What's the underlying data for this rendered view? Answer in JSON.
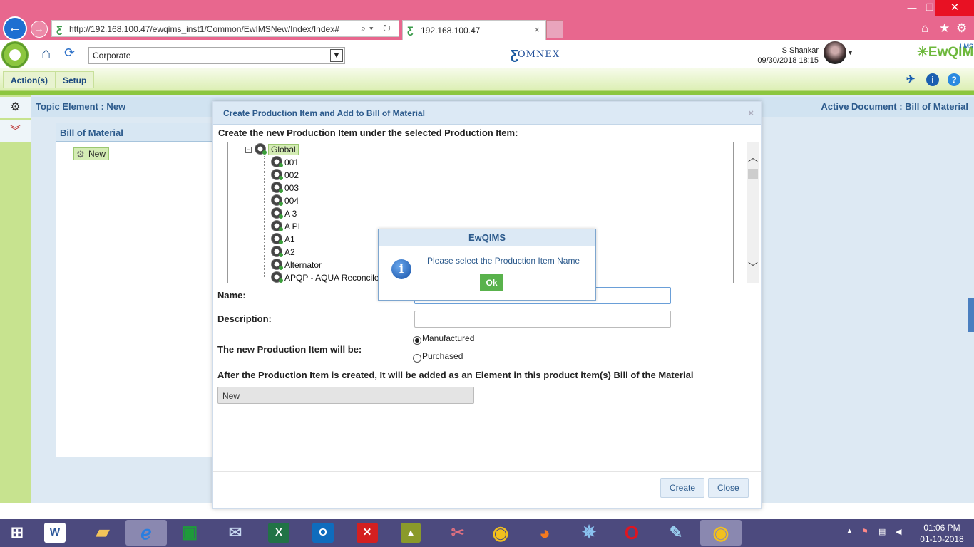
{
  "browser": {
    "url": "http://192.168.100.47/ewqims_inst1/Common/EwIMSNew/Index/Index#",
    "tab_title": "192.168.100.47",
    "tab_close": "×",
    "url_tools": "⌕▾ ↻"
  },
  "header": {
    "org_select_value": "Corporate",
    "omnex_brand": "OMNEX",
    "user_name": "S Shankar",
    "user_datetime": "09/30/2018 18:15",
    "app_brand": "EwQIMS",
    "app_brand_lms": "LMS"
  },
  "toolbar": {
    "actions_label": "Action(s)",
    "setup_label": "Setup"
  },
  "page": {
    "topic_title": "Topic Element : New",
    "active_document": "Active Document : Bill of Material",
    "bom_title": "Bill of Material",
    "bom_node": "New"
  },
  "modal": {
    "title": "Create Production Item and Add to Bill of Material",
    "subtitle": "Create the new Production Item under the selected Production Item:",
    "tree_root": "Global",
    "tree_items": [
      "001",
      "002",
      "003",
      "004",
      "A 3",
      "A PI",
      "A1",
      "A2",
      "Alternator",
      "APQP - AQUA Reconcile"
    ],
    "name_label": "Name:",
    "description_label": "Description:",
    "item_type_label": "The new Production Item will be:",
    "option_manufactured": "Manufactured",
    "option_purchased": "Purchased",
    "selected_option": "Manufactured",
    "info_text": "After the Production Item is created, It will be added as an Element in this product item(s) Bill of the Material",
    "parent_value": "New",
    "create_label": "Create",
    "close_label": "Close"
  },
  "alert": {
    "title": "EwQIMS",
    "message": "Please select the Production Item Name",
    "ok_label": "Ok"
  },
  "taskbar": {
    "time": "01:06 PM",
    "date": "01-10-2018",
    "apps": [
      "start",
      "word",
      "file-explorer",
      "internet-explorer",
      "store",
      "thunderbird",
      "excel",
      "outlook",
      "app-red",
      "app-chart",
      "app-paint",
      "chrome",
      "firefox",
      "safari",
      "opera",
      "paint",
      "chrome"
    ]
  },
  "colors": {
    "browser_bar": "#e8678e",
    "toolbar_green": "#8cc63f",
    "title_blue": "#2c5a8c",
    "ok_green": "#59b24c",
    "taskbar": "#4c4a7e"
  }
}
